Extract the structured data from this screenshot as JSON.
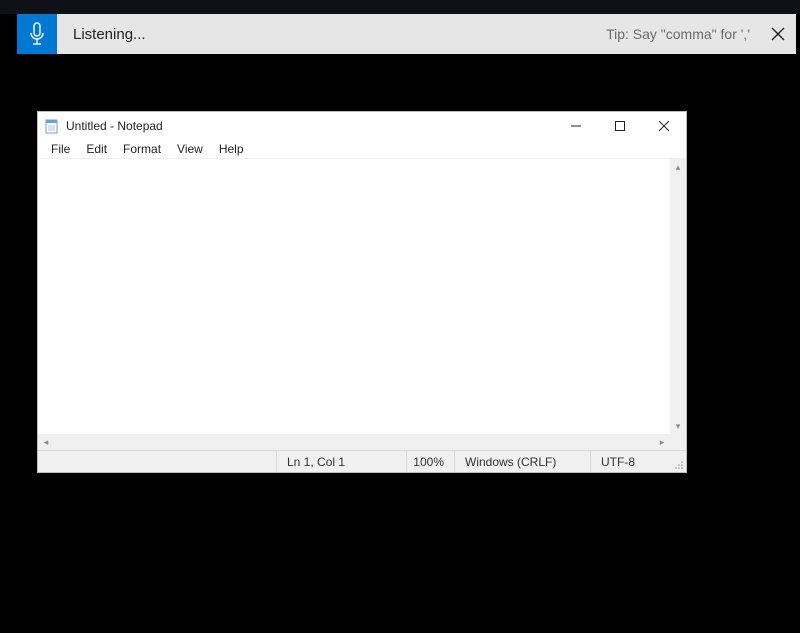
{
  "voice": {
    "status": "Listening...",
    "tip": "Tip: Say \"comma\" for ','"
  },
  "notepad": {
    "title": "Untitled - Notepad",
    "menu": {
      "file": "File",
      "edit": "Edit",
      "format": "Format",
      "view": "View",
      "help": "Help"
    },
    "status": {
      "position": "Ln 1, Col 1",
      "zoom": "100%",
      "eol": "Windows (CRLF)",
      "encoding": "UTF-8"
    }
  }
}
